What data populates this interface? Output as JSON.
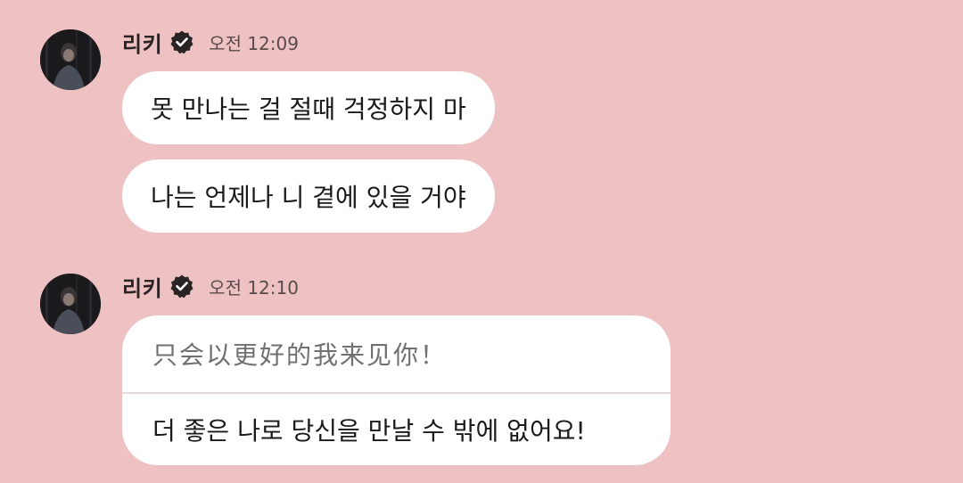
{
  "colors": {
    "background": "#eec1c3",
    "bubble": "#ffffff",
    "name_text": "#2a2324",
    "time_text": "#5a4a4c",
    "verified_badge": "#2a2324",
    "original_text": "#707070",
    "divider": "#e2dadb"
  },
  "messages": [
    {
      "sender": "리키",
      "verified_icon": "verified-badge-icon",
      "time": "오전 12:09",
      "bubbles": [
        "못 만나는 걸 절때 걱정하지 마",
        "나는 언제나 니 곁에 있을 거야"
      ]
    },
    {
      "sender": "리키",
      "verified_icon": "verified-badge-icon",
      "time": "오전 12:10",
      "translation": {
        "original": "只会以更好的我来见你！",
        "translated": "더 좋은 나로 당신을 만날 수 밖에 없어요!"
      }
    }
  ]
}
